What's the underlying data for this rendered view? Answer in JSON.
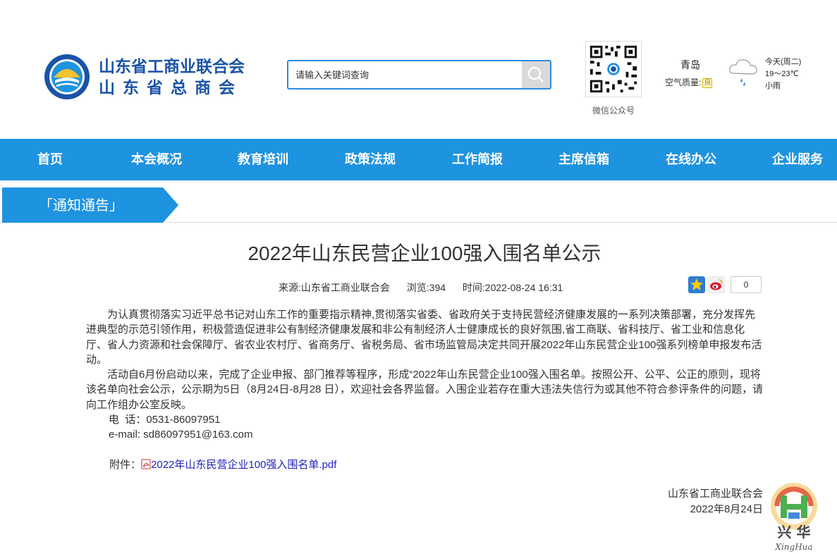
{
  "header": {
    "org_name_1": "山东省工商业联合会",
    "org_name_2": "山东省总商会",
    "search_placeholder": "请输入关键词查询",
    "qr_label": "微信公众号",
    "weather": {
      "city": "青岛",
      "air_quality_label": "空气质量:",
      "air_quality_value": "良",
      "day": "今天(周二)",
      "temp": "19～23℃",
      "condition": "小雨"
    }
  },
  "nav": {
    "items": [
      "首页",
      "本会概况",
      "教育培训",
      "政策法规",
      "工作简报",
      "主席信箱",
      "在线办公",
      "企业服务"
    ]
  },
  "section": {
    "label": "「通知通告」"
  },
  "article": {
    "title": "2022年山东民营企业100强入围名单公示",
    "source": "来源:山东省工商业联合会",
    "views": "浏览:394",
    "time": "时间:2022-08-24 16:31",
    "share_count": "0",
    "para1": "为认真贯彻落实习近平总书记对山东工作的重要指示精神,贯彻落实省委、省政府关于支持民营经济健康发展的一系列决策部署，充分发挥先进典型的示范引领作用，积极营造促进非公有制经济健康发展和非公有制经济人士健康成长的良好氛围,省工商联、省科技厅、省工业和信息化厅、省人力资源和社会保障厅、省农业农村厅、省商务厅、省税务局、省市场监管局决定共同开展2022年山东民营企业100强系列榜单申报发布活动。",
    "para2": "活动自6月份启动以来，完成了企业申报、部门推荐等程序，形成“2022年山东民营企业100强入围名单。按照公开、公平、公正的原则，现将该名单向社会公示，公示期为5日（8月24日-8月28 日），欢迎社会各界监督。入围企业若存在重大违法失信行为或其他不符合参评条件的问题，请向工作组办公室反映。",
    "phone": "电  话：0531-86097951",
    "email": "e-mail: sd86097951@163.com",
    "attach_label": "附件：",
    "attach_file": "2022年山东民营企业100强入围名单.pdf",
    "sign_org": "山东省工商业联合会",
    "sign_date": "2022年8月24日"
  },
  "watermark": {
    "text1": "兴 华",
    "text2": "XingHua"
  },
  "colors": {
    "primary": "#1e93e0",
    "brand": "#1a53a8"
  }
}
